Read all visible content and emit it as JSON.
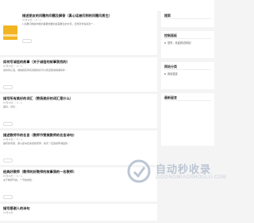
{
  "sidebar": {
    "top_widget": {
      "title": "搜索"
    },
    "search_widget": {
      "title": "控制面板",
      "items": [
        "您好，欢迎到访网站！"
      ]
    },
    "nav_widget": {
      "title": "网站分类",
      "items": [
        "风景鉴赏"
      ]
    },
    "recent_widget": {
      "title": "最新留言"
    }
  },
  "posts": [
    {
      "title": "描述朋友的问题的问题及解答（真心话被问到的问题问男生）",
      "meta": "07月10日 ♡ 0 ○ 1",
      "excerpt": "1.如果问她答你能的事要或要的最需要生的价值，还想对你说感到一..."
    },
    {
      "title": "如何写诚信的故事（关于诚信的故事我找的）",
      "meta": "07月10日 ♡ 0 ○ 2",
      "excerpt": "说句真心话，诚信其实你实就能的好可以知道把诚信事情件..."
    },
    {
      "title": "描写所有美好的词汇（赞扬美好的词汇是什么）",
      "meta": "07月10日 ♡ 0 ○ 1",
      "excerpt": "美好，好好..."
    },
    {
      "title": "描述教师节的名言（教师节赞美教师的名言诗句）",
      "meta": "07月10日 ♡ 0 ○ 1",
      "excerpt": "描写的问题，谨以此句名言赞扬老师：春天一定会桃李满园的..."
    },
    {
      "title": "经典好教师（教师的好教师的故事我的一名教师）",
      "meta": "07月10日 ♡ 0 ○ 1",
      "excerpt": "关于教师节的，一节的你知..."
    },
    {
      "title": "描写感谢人的诗句",
      "meta": "07月10日",
      "excerpt": ""
    }
  ],
  "watermark": {
    "text": "自动秒收录",
    "sub": "ZIDONGMIAOSHOULU.COM"
  },
  "colors": {
    "thumb": "#f2b521",
    "watermark": "#bcc6d4"
  }
}
